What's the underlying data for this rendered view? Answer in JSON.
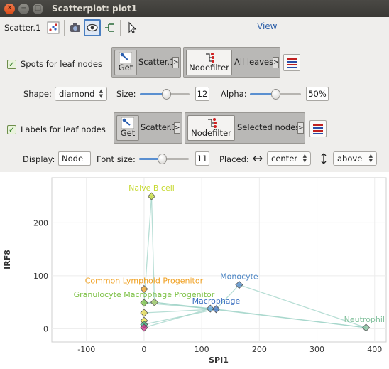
{
  "window": {
    "title": "Scatterplot: plot1"
  },
  "toolbar": {
    "label": "Scatter.1",
    "view_label": "View"
  },
  "spots": {
    "checkbox_label": "Spots for leaf nodes",
    "get_label": "Get",
    "source_text": "Scatter.1",
    "nodefilter_label": "Nodefilter",
    "filter_text": "All leaves",
    "shape_label": "Shape:",
    "shape_value": "diamond",
    "size_label": "Size:",
    "size_value": "12",
    "size_fraction": 0.55,
    "alpha_label": "Alpha:",
    "alpha_value": "50%",
    "alpha_fraction": 0.5
  },
  "labels": {
    "checkbox_label": "Labels for leaf nodes",
    "get_label": "Get",
    "source_text": "Scatter.1",
    "nodefilter_label": "Nodefilter",
    "filter_text": "Selected nodes",
    "display_label": "Display:",
    "display_value": "Node",
    "fontsize_label": "Font size:",
    "fontsize_value": "11",
    "fontsize_fraction": 0.45,
    "placed_label": "Placed:",
    "placed_h_value": "center",
    "placed_v_value": "above"
  },
  "colors": {
    "naive_b_cell": "#c6d930",
    "common_lymphoid_progenitor": "#f0a020",
    "granulocyte_macrophage_progenitor": "#7bc043",
    "monocyte": "#4a84c4",
    "macrophage": "#3a6fc0",
    "neutrophil": "#7fbf9a",
    "link": "#9fd3c7"
  },
  "chart_data": {
    "type": "scatter",
    "xlabel": "SPI1",
    "ylabel": "IRF8",
    "xlim": [
      -160,
      420
    ],
    "ylim": [
      -25,
      285
    ],
    "xticks": [
      "-100",
      "0",
      "100",
      "200",
      "300",
      "400"
    ],
    "yticks": [
      "0",
      "100",
      "200"
    ],
    "labeled_points": [
      {
        "name": "Naive B cell",
        "x": 13,
        "y": 250
      },
      {
        "name": "Common Lymphoid Progenitor",
        "x": 0,
        "y": 75
      },
      {
        "name": "Granulocyte Macrophage Progenitor",
        "x": 0,
        "y": 49
      },
      {
        "name": "Monocyte",
        "x": 165,
        "y": 83
      },
      {
        "name": "Macrophage",
        "x": 125,
        "y": 37
      },
      {
        "name": "Neutrophil",
        "x": 385,
        "y": 2
      }
    ],
    "unlabeled_points": [
      {
        "x": 0,
        "y": 30
      },
      {
        "x": 0,
        "y": 15
      },
      {
        "x": 0,
        "y": 8
      },
      {
        "x": 0,
        "y": 2
      },
      {
        "x": 115,
        "y": 38
      },
      {
        "x": 18,
        "y": 50
      }
    ]
  }
}
